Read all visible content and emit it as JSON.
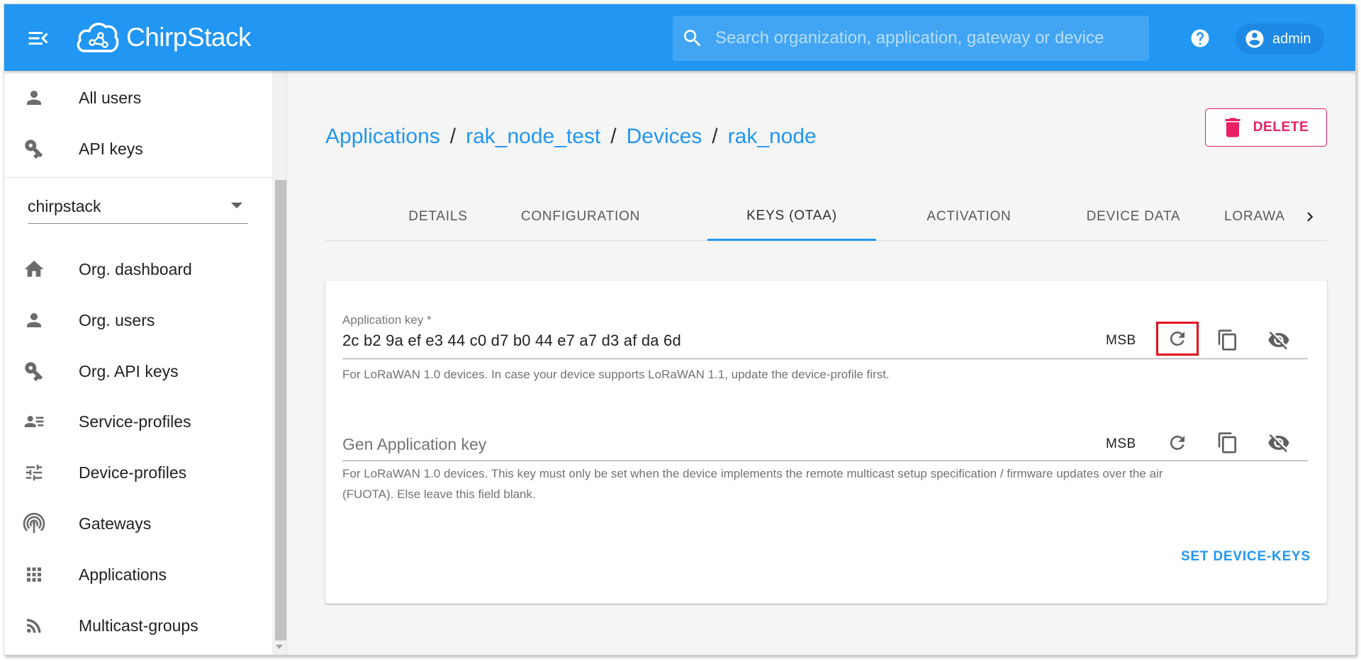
{
  "topbar": {
    "brand": "ChirpStack",
    "search_placeholder": "Search organization, application, gateway or device",
    "user": "admin"
  },
  "sidebar": {
    "top_items": [
      {
        "label": "All users",
        "icon": "person-icon"
      },
      {
        "label": "API keys",
        "icon": "key-icon"
      }
    ],
    "org_select": "chirpstack",
    "org_items": [
      {
        "label": "Org. dashboard",
        "icon": "home-icon"
      },
      {
        "label": "Org. users",
        "icon": "person-icon"
      },
      {
        "label": "Org. API keys",
        "icon": "key-icon"
      },
      {
        "label": "Service-profiles",
        "icon": "account-details-icon"
      },
      {
        "label": "Device-profiles",
        "icon": "tune-icon"
      },
      {
        "label": "Gateways",
        "icon": "gateway-icon"
      },
      {
        "label": "Applications",
        "icon": "apps-icon"
      },
      {
        "label": "Multicast-groups",
        "icon": "rss-icon"
      }
    ]
  },
  "breadcrumb": {
    "applications": "Applications",
    "application": "rak_node_test",
    "devices": "Devices",
    "device": "rak_node",
    "separator": "/"
  },
  "delete_button": "DELETE",
  "tabs": [
    {
      "label": "DETAILS",
      "active": false
    },
    {
      "label": "CONFIGURATION",
      "active": false
    },
    {
      "label": "KEYS (OTAA)",
      "active": true
    },
    {
      "label": "ACTIVATION",
      "active": false
    },
    {
      "label": "DEVICE DATA",
      "active": false
    },
    {
      "label": "LORAWA",
      "active": false
    }
  ],
  "keys_form": {
    "app_key": {
      "label": "Application key *",
      "value": "2c b2 9a ef e3 44 c0 d7 b0 44 e7 a7 d3 af da 6d",
      "byte_order": "MSB",
      "helper": "For LoRaWAN 1.0 devices. In case your device supports LoRaWAN 1.1, update the device-profile first."
    },
    "gen_app_key": {
      "placeholder": "Gen Application key",
      "value": "",
      "byte_order": "MSB",
      "helper_line1": "For LoRaWAN 1.0 devices. This key must only be set when the device implements the remote multicast setup specification / firmware updates over the air",
      "helper_line2": "(FUOTA). Else leave this field blank."
    },
    "submit": "SET DEVICE-KEYS"
  },
  "colors": {
    "primary": "#2196f3",
    "delete": "#e91e63",
    "highlight": "#e3101d"
  }
}
